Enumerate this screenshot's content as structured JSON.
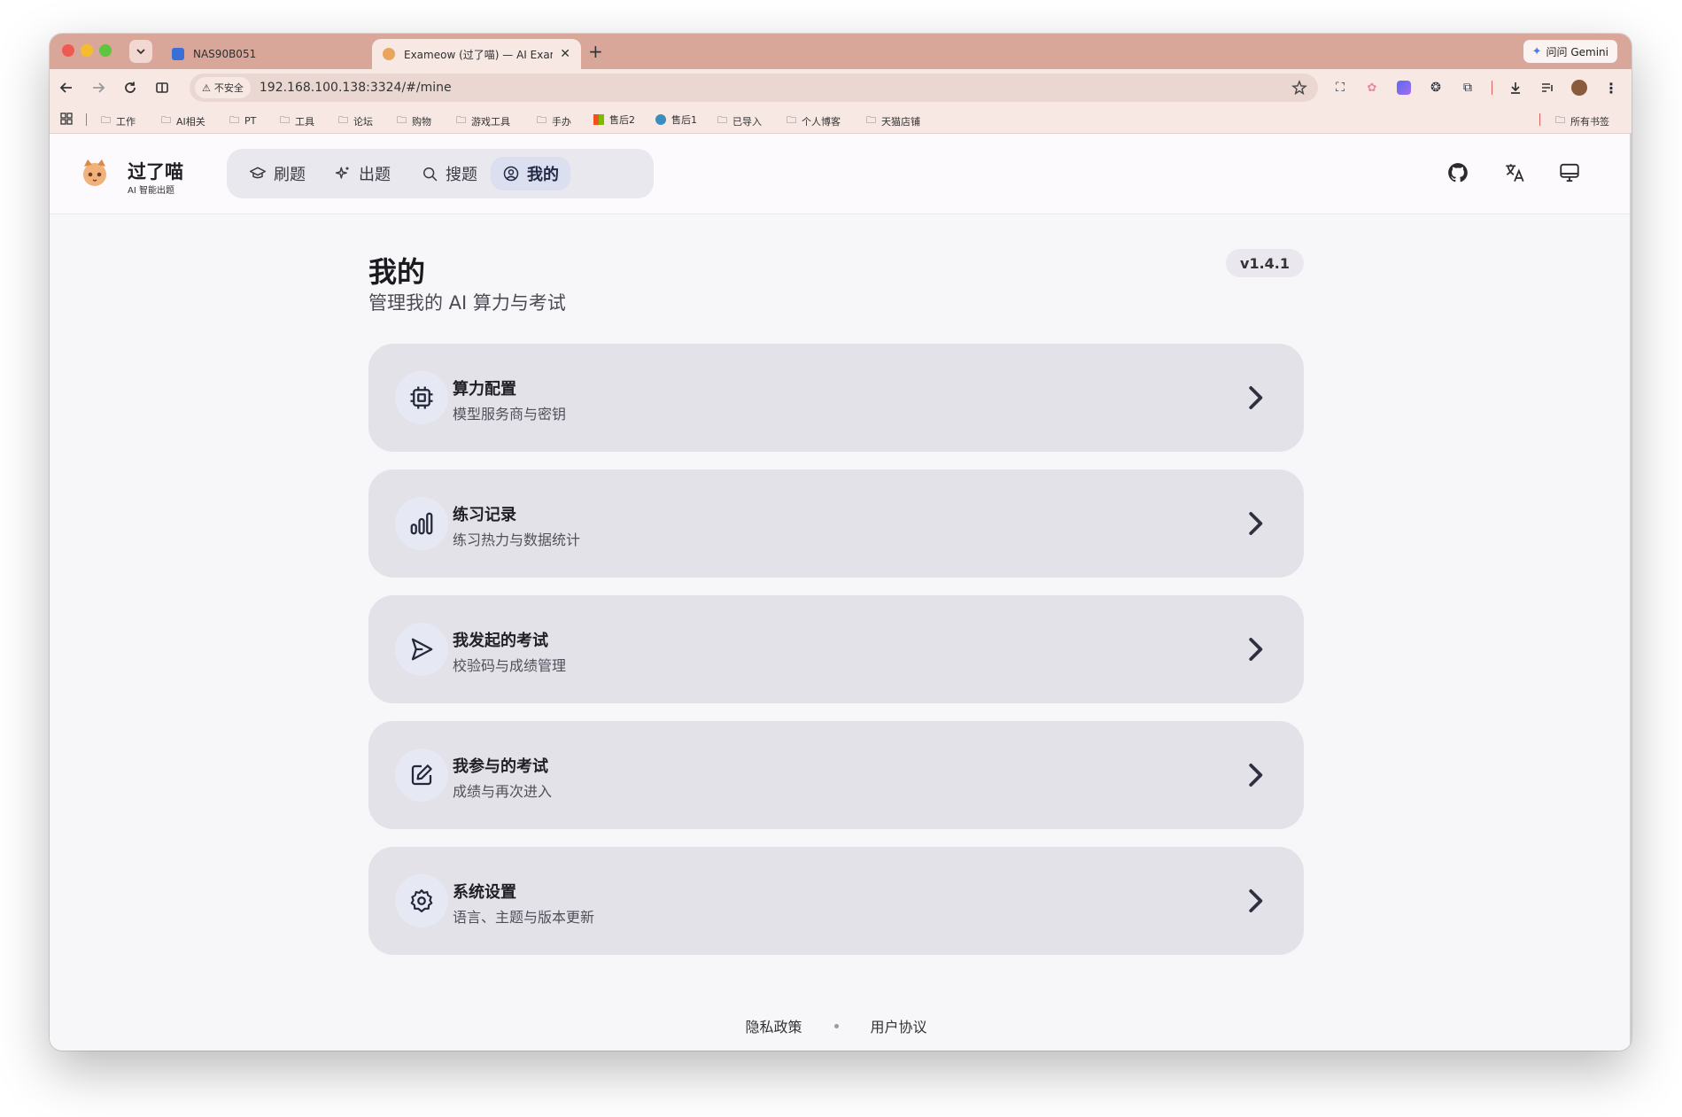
{
  "browser": {
    "tabs": [
      {
        "title": "NAS90B051",
        "active": false
      },
      {
        "title": "Exameow (过了喵) — AI Exam",
        "active": true
      }
    ],
    "gemini_label": "问问 Gemini",
    "security_label": "不安全",
    "url": "192.168.100.138:3324/#/mine",
    "bookmarks": [
      "工作",
      "AI相关",
      "PT",
      "工具",
      "论坛",
      "购物",
      "游戏工具",
      "手办",
      "售后2",
      "售后1",
      "已导入",
      "个人博客",
      "天猫店铺"
    ],
    "all_bookmarks_label": "所有书签"
  },
  "app": {
    "brand_name": "过了喵",
    "brand_sub": "AI 智能出题",
    "nav": [
      {
        "label": "刷题",
        "icon": "graduation-cap-icon",
        "active": false
      },
      {
        "label": "出题",
        "icon": "sparkles-icon",
        "active": false
      },
      {
        "label": "搜题",
        "icon": "search-icon",
        "active": false
      },
      {
        "label": "我的",
        "icon": "user-circle-icon",
        "active": true
      }
    ],
    "header_icons": [
      "github-icon",
      "translate-icon",
      "monitor-icon"
    ]
  },
  "main": {
    "title": "我的",
    "subtitle": "管理我的 AI 算力与考试",
    "version": "v1.4.1",
    "cards": [
      {
        "title": "算力配置",
        "desc": "模型服务商与密钥",
        "icon": "cpu-icon"
      },
      {
        "title": "练习记录",
        "desc": "练习热力与数据统计",
        "icon": "bar-chart-icon"
      },
      {
        "title": "我发起的考试",
        "desc": "校验码与成绩管理",
        "icon": "send-icon"
      },
      {
        "title": "我参与的考试",
        "desc": "成绩与再次进入",
        "icon": "edit-icon"
      },
      {
        "title": "系统设置",
        "desc": "语言、主题与版本更新",
        "icon": "settings-icon"
      }
    ]
  },
  "footer": {
    "links": [
      "隐私政策",
      "用户协议"
    ]
  },
  "colors": {
    "tabbar": "#d9a79a",
    "toolbar": "#f7e8e4",
    "card_bg": "#e4e2e9",
    "nav_active": "#dcdff0",
    "page_bg": "#f7f6f9"
  }
}
